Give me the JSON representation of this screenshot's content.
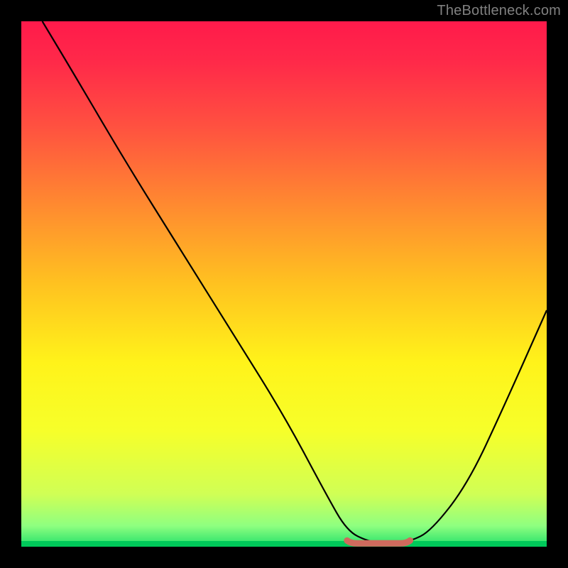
{
  "watermark": "TheBottleneck.com",
  "colors": {
    "frame": "#000000",
    "curve": "#000000",
    "marker": "#cf6a5d",
    "gradient_stops": [
      {
        "offset": 0.0,
        "color": "#ff1a4b"
      },
      {
        "offset": 0.08,
        "color": "#ff2a49"
      },
      {
        "offset": 0.2,
        "color": "#ff5140"
      },
      {
        "offset": 0.35,
        "color": "#ff8a30"
      },
      {
        "offset": 0.5,
        "color": "#ffc220"
      },
      {
        "offset": 0.65,
        "color": "#fff31a"
      },
      {
        "offset": 0.78,
        "color": "#f6ff2a"
      },
      {
        "offset": 0.9,
        "color": "#d0ff55"
      },
      {
        "offset": 0.96,
        "color": "#8fff80"
      },
      {
        "offset": 1.0,
        "color": "#22e06a"
      }
    ],
    "bottom_band": "#00c95a"
  },
  "chart_data": {
    "type": "line",
    "title": "",
    "xlabel": "",
    "ylabel": "",
    "xlim": [
      0,
      100
    ],
    "ylim": [
      0,
      100
    ],
    "curve": {
      "x": [
        4,
        10,
        20,
        30,
        40,
        50,
        58,
        62,
        66,
        70,
        74,
        78,
        85,
        92,
        100
      ],
      "y": [
        100,
        90,
        73,
        57,
        41,
        25,
        10,
        3,
        1,
        0.5,
        1,
        3,
        12,
        27,
        45
      ]
    },
    "marker_segment": {
      "x0": 62,
      "x1": 74,
      "y": 0.5
    }
  }
}
